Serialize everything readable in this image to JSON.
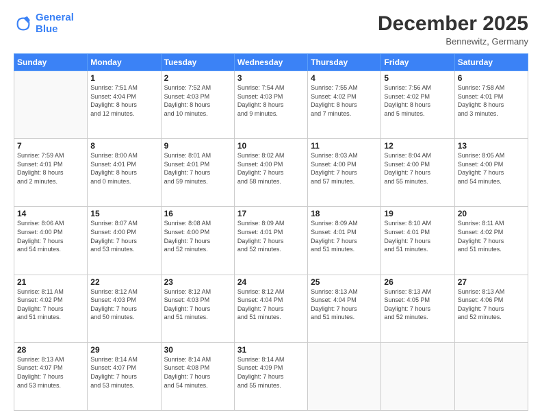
{
  "header": {
    "logo_line1": "General",
    "logo_line2": "Blue",
    "title": "December 2025",
    "subtitle": "Bennewitz, Germany"
  },
  "calendar": {
    "days_of_week": [
      "Sunday",
      "Monday",
      "Tuesday",
      "Wednesday",
      "Thursday",
      "Friday",
      "Saturday"
    ],
    "weeks": [
      [
        {
          "day": "",
          "info": ""
        },
        {
          "day": "1",
          "info": "Sunrise: 7:51 AM\nSunset: 4:04 PM\nDaylight: 8 hours\nand 12 minutes."
        },
        {
          "day": "2",
          "info": "Sunrise: 7:52 AM\nSunset: 4:03 PM\nDaylight: 8 hours\nand 10 minutes."
        },
        {
          "day": "3",
          "info": "Sunrise: 7:54 AM\nSunset: 4:03 PM\nDaylight: 8 hours\nand 9 minutes."
        },
        {
          "day": "4",
          "info": "Sunrise: 7:55 AM\nSunset: 4:02 PM\nDaylight: 8 hours\nand 7 minutes."
        },
        {
          "day": "5",
          "info": "Sunrise: 7:56 AM\nSunset: 4:02 PM\nDaylight: 8 hours\nand 5 minutes."
        },
        {
          "day": "6",
          "info": "Sunrise: 7:58 AM\nSunset: 4:01 PM\nDaylight: 8 hours\nand 3 minutes."
        }
      ],
      [
        {
          "day": "7",
          "info": "Sunrise: 7:59 AM\nSunset: 4:01 PM\nDaylight: 8 hours\nand 2 minutes."
        },
        {
          "day": "8",
          "info": "Sunrise: 8:00 AM\nSunset: 4:01 PM\nDaylight: 8 hours\nand 0 minutes."
        },
        {
          "day": "9",
          "info": "Sunrise: 8:01 AM\nSunset: 4:01 PM\nDaylight: 7 hours\nand 59 minutes."
        },
        {
          "day": "10",
          "info": "Sunrise: 8:02 AM\nSunset: 4:00 PM\nDaylight: 7 hours\nand 58 minutes."
        },
        {
          "day": "11",
          "info": "Sunrise: 8:03 AM\nSunset: 4:00 PM\nDaylight: 7 hours\nand 57 minutes."
        },
        {
          "day": "12",
          "info": "Sunrise: 8:04 AM\nSunset: 4:00 PM\nDaylight: 7 hours\nand 55 minutes."
        },
        {
          "day": "13",
          "info": "Sunrise: 8:05 AM\nSunset: 4:00 PM\nDaylight: 7 hours\nand 54 minutes."
        }
      ],
      [
        {
          "day": "14",
          "info": "Sunrise: 8:06 AM\nSunset: 4:00 PM\nDaylight: 7 hours\nand 54 minutes."
        },
        {
          "day": "15",
          "info": "Sunrise: 8:07 AM\nSunset: 4:00 PM\nDaylight: 7 hours\nand 53 minutes."
        },
        {
          "day": "16",
          "info": "Sunrise: 8:08 AM\nSunset: 4:00 PM\nDaylight: 7 hours\nand 52 minutes."
        },
        {
          "day": "17",
          "info": "Sunrise: 8:09 AM\nSunset: 4:01 PM\nDaylight: 7 hours\nand 52 minutes."
        },
        {
          "day": "18",
          "info": "Sunrise: 8:09 AM\nSunset: 4:01 PM\nDaylight: 7 hours\nand 51 minutes."
        },
        {
          "day": "19",
          "info": "Sunrise: 8:10 AM\nSunset: 4:01 PM\nDaylight: 7 hours\nand 51 minutes."
        },
        {
          "day": "20",
          "info": "Sunrise: 8:11 AM\nSunset: 4:02 PM\nDaylight: 7 hours\nand 51 minutes."
        }
      ],
      [
        {
          "day": "21",
          "info": "Sunrise: 8:11 AM\nSunset: 4:02 PM\nDaylight: 7 hours\nand 51 minutes."
        },
        {
          "day": "22",
          "info": "Sunrise: 8:12 AM\nSunset: 4:03 PM\nDaylight: 7 hours\nand 50 minutes."
        },
        {
          "day": "23",
          "info": "Sunrise: 8:12 AM\nSunset: 4:03 PM\nDaylight: 7 hours\nand 51 minutes."
        },
        {
          "day": "24",
          "info": "Sunrise: 8:12 AM\nSunset: 4:04 PM\nDaylight: 7 hours\nand 51 minutes."
        },
        {
          "day": "25",
          "info": "Sunrise: 8:13 AM\nSunset: 4:04 PM\nDaylight: 7 hours\nand 51 minutes."
        },
        {
          "day": "26",
          "info": "Sunrise: 8:13 AM\nSunset: 4:05 PM\nDaylight: 7 hours\nand 52 minutes."
        },
        {
          "day": "27",
          "info": "Sunrise: 8:13 AM\nSunset: 4:06 PM\nDaylight: 7 hours\nand 52 minutes."
        }
      ],
      [
        {
          "day": "28",
          "info": "Sunrise: 8:13 AM\nSunset: 4:07 PM\nDaylight: 7 hours\nand 53 minutes."
        },
        {
          "day": "29",
          "info": "Sunrise: 8:14 AM\nSunset: 4:07 PM\nDaylight: 7 hours\nand 53 minutes."
        },
        {
          "day": "30",
          "info": "Sunrise: 8:14 AM\nSunset: 4:08 PM\nDaylight: 7 hours\nand 54 minutes."
        },
        {
          "day": "31",
          "info": "Sunrise: 8:14 AM\nSunset: 4:09 PM\nDaylight: 7 hours\nand 55 minutes."
        },
        {
          "day": "",
          "info": ""
        },
        {
          "day": "",
          "info": ""
        },
        {
          "day": "",
          "info": ""
        }
      ]
    ]
  }
}
